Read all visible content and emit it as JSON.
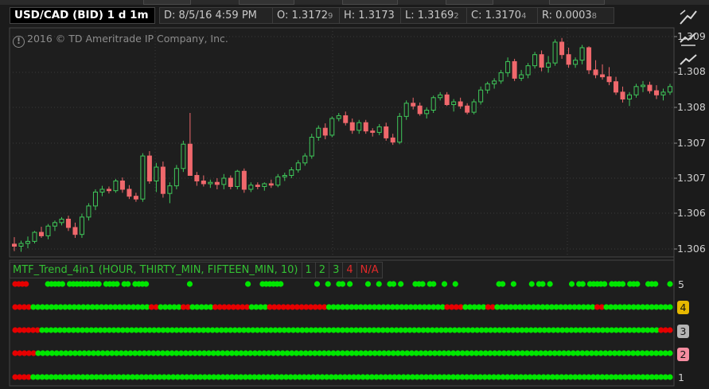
{
  "header": {
    "symbol": "USD/CAD (BID) 1 d 1m",
    "date": "D: 8/5/16 4:59 PM",
    "open": "O: 1.3172",
    "open_sub": "9",
    "high": "H: 1.3173",
    "low": "L: 1.3169",
    "low_sub": "2",
    "close": "C: 1.3170",
    "close_sub": "4",
    "range": "R: 0.0003",
    "range_sub": "8"
  },
  "copyright": "2016 © TD Ameritrade IP Company, Inc.",
  "price_axis": {
    "labels": [
      "1.309",
      "1.308",
      "1.308",
      "1.307",
      "1.307",
      "1.306",
      "1.306"
    ]
  },
  "study": {
    "name": "MTF_Trend_4in1 (HOUR, THIRTY_MIN, FIFTEEN_MIN, 10)",
    "plot1": "1",
    "plot2": "2",
    "plot3": "3",
    "plot4": "4",
    "na": "N/A",
    "row_labels": [
      "5",
      "4",
      "3",
      "2",
      "1"
    ]
  },
  "colors": {
    "up": "#3fc85a",
    "down": "#f0686c",
    "dot_green": "#00e600",
    "dot_red": "#e60000",
    "badge4": "#e6b800",
    "badge3": "#b4b4b4",
    "badge2": "#f58ca0"
  },
  "chart_data": {
    "type": "candlestick",
    "price_range": [
      1.30595,
      1.3091
    ],
    "candles": [
      [
        1.30611,
        1.30621,
        1.30601,
        1.30608
      ],
      [
        1.30608,
        1.30616,
        1.306,
        1.30612
      ],
      [
        1.30612,
        1.30622,
        1.30605,
        1.30615
      ],
      [
        1.30615,
        1.3063,
        1.30612,
        1.30628
      ],
      [
        1.30628,
        1.30636,
        1.3062,
        1.30623
      ],
      [
        1.30623,
        1.3064,
        1.30618,
        1.30637
      ],
      [
        1.30637,
        1.30645,
        1.3063,
        1.30642
      ],
      [
        1.30642,
        1.3065,
        1.30638,
        1.30647
      ],
      [
        1.30647,
        1.30652,
        1.3063,
        1.30635
      ],
      [
        1.30635,
        1.30642,
        1.3062,
        1.30625
      ],
      [
        1.30625,
        1.30655,
        1.3062,
        1.3065
      ],
      [
        1.3065,
        1.3067,
        1.30645,
        1.30666
      ],
      [
        1.30666,
        1.3069,
        1.3066,
        1.30686
      ],
      [
        1.30686,
        1.30695,
        1.3068,
        1.3069
      ],
      [
        1.3069,
        1.30694,
        1.30684,
        1.30688
      ],
      [
        1.30688,
        1.30705,
        1.30685,
        1.30702
      ],
      [
        1.30702,
        1.30707,
        1.30685,
        1.3069
      ],
      [
        1.3069,
        1.30696,
        1.30676,
        1.3068
      ],
      [
        1.3068,
        1.30685,
        1.30672,
        1.30676
      ],
      [
        1.30676,
        1.30742,
        1.30672,
        1.30738
      ],
      [
        1.30738,
        1.30745,
        1.30698,
        1.30702
      ],
      [
        1.30702,
        1.30728,
        1.30686,
        1.30722
      ],
      [
        1.30722,
        1.3073,
        1.30678,
        1.30684
      ],
      [
        1.30684,
        1.307,
        1.3067,
        1.30695
      ],
      [
        1.30695,
        1.30725,
        1.3069,
        1.3072
      ],
      [
        1.3072,
        1.3076,
        1.30715,
        1.30755
      ],
      [
        1.30755,
        1.308,
        1.30735,
        1.3071
      ],
      [
        1.3071,
        1.30715,
        1.30695,
        1.30702
      ],
      [
        1.30702,
        1.3071,
        1.30694,
        1.30698
      ],
      [
        1.30698,
        1.30704,
        1.30692,
        1.307
      ],
      [
        1.307,
        1.30706,
        1.3069,
        1.30697
      ],
      [
        1.30697,
        1.30712,
        1.3069,
        1.30706
      ],
      [
        1.30706,
        1.3071,
        1.3069,
        1.30694
      ],
      [
        1.30694,
        1.30718,
        1.3069,
        1.30716
      ],
      [
        1.30716,
        1.3072,
        1.30685,
        1.3069
      ],
      [
        1.3069,
        1.307,
        1.30686,
        1.30696
      ],
      [
        1.30696,
        1.307,
        1.3069,
        1.30694
      ],
      [
        1.30694,
        1.307,
        1.30688,
        1.30698
      ],
      [
        1.30698,
        1.30704,
        1.30692,
        1.30696
      ],
      [
        1.30696,
        1.30712,
        1.30693,
        1.30708
      ],
      [
        1.30708,
        1.30714,
        1.30702,
        1.3071
      ],
      [
        1.3071,
        1.30722,
        1.30706,
        1.30718
      ],
      [
        1.30718,
        1.30732,
        1.30714,
        1.30728
      ],
      [
        1.30728,
        1.30742,
        1.30724,
        1.30738
      ],
      [
        1.30738,
        1.3077,
        1.30734,
        1.30765
      ],
      [
        1.30765,
        1.30782,
        1.3076,
        1.30778
      ],
      [
        1.30778,
        1.30785,
        1.30762,
        1.30768
      ],
      [
        1.30768,
        1.30795,
        1.30765,
        1.30792
      ],
      [
        1.30792,
        1.308,
        1.30788,
        1.30796
      ],
      [
        1.30796,
        1.30802,
        1.30782,
        1.30786
      ],
      [
        1.30786,
        1.30792,
        1.3077,
        1.30775
      ],
      [
        1.30775,
        1.3079,
        1.3077,
        1.30786
      ],
      [
        1.30786,
        1.3079,
        1.3077,
        1.30774
      ],
      [
        1.30774,
        1.30778,
        1.30766,
        1.30772
      ],
      [
        1.30772,
        1.30784,
        1.30768,
        1.3078
      ],
      [
        1.3078,
        1.30786,
        1.3076,
        1.30764
      ],
      [
        1.30764,
        1.3077,
        1.30754,
        1.30758
      ],
      [
        1.30758,
        1.308,
        1.30755,
        1.30795
      ],
      [
        1.30795,
        1.30818,
        1.3079,
        1.30814
      ],
      [
        1.30814,
        1.30822,
        1.30805,
        1.3081
      ],
      [
        1.3081,
        1.30815,
        1.30796,
        1.30799
      ],
      [
        1.30799,
        1.30808,
        1.30792,
        1.30804
      ],
      [
        1.30804,
        1.30825,
        1.308,
        1.30822
      ],
      [
        1.30822,
        1.3083,
        1.30818,
        1.30826
      ],
      [
        1.30826,
        1.3083,
        1.3081,
        1.30812
      ],
      [
        1.30812,
        1.3082,
        1.30802,
        1.30816
      ],
      [
        1.30816,
        1.30822,
        1.30806,
        1.3081
      ],
      [
        1.3081,
        1.30814,
        1.30798,
        1.30801
      ],
      [
        1.30801,
        1.3082,
        1.30798,
        1.30816
      ],
      [
        1.30816,
        1.30838,
        1.30812,
        1.30833
      ],
      [
        1.30833,
        1.30845,
        1.30828,
        1.30842
      ],
      [
        1.30842,
        1.3085,
        1.30835,
        1.30846
      ],
      [
        1.30846,
        1.30862,
        1.30842,
        1.30858
      ],
      [
        1.30858,
        1.3088,
        1.30852,
        1.30874
      ],
      [
        1.30874,
        1.30878,
        1.30846,
        1.3085
      ],
      [
        1.3085,
        1.30862,
        1.30846,
        1.30855
      ],
      [
        1.30855,
        1.30872,
        1.3085,
        1.30868
      ],
      [
        1.30868,
        1.30888,
        1.30864,
        1.30884
      ],
      [
        1.30884,
        1.3089,
        1.3086,
        1.30866
      ],
      [
        1.30866,
        1.30882,
        1.30858,
        1.30872
      ],
      [
        1.30872,
        1.30906,
        1.30868,
        1.30902
      ],
      [
        1.30902,
        1.30908,
        1.30878,
        1.30884
      ],
      [
        1.30884,
        1.30894,
        1.30865,
        1.3087
      ],
      [
        1.3087,
        1.3088,
        1.30865,
        1.30876
      ],
      [
        1.30876,
        1.30898,
        1.3087,
        1.30894
      ],
      [
        1.30894,
        1.30896,
        1.30856,
        1.30862
      ],
      [
        1.30862,
        1.30876,
        1.3085,
        1.30855
      ],
      [
        1.30855,
        1.3087,
        1.30848,
        1.30852
      ],
      [
        1.30852,
        1.30866,
        1.3084,
        1.30845
      ],
      [
        1.30845,
        1.30852,
        1.30826,
        1.3083
      ],
      [
        1.3083,
        1.30838,
        1.30815,
        1.3082
      ],
      [
        1.3082,
        1.3083,
        1.3081,
        1.30826
      ],
      [
        1.30826,
        1.30842,
        1.30822,
        1.30838
      ],
      [
        1.30838,
        1.30846,
        1.3083,
        1.3084
      ],
      [
        1.3084,
        1.30845,
        1.30828,
        1.30832
      ],
      [
        1.30832,
        1.3084,
        1.3082,
        1.30826
      ],
      [
        1.30826,
        1.30835,
        1.30818,
        1.3083
      ],
      [
        1.3083,
        1.30842,
        1.30826,
        1.30838
      ]
    ],
    "trend_rows": [
      {
        "label": "5",
        "values": "RRRR_____GGGGG_GGGGGGGGG_GGGG_GG_GGGG___________G_______________G___GGGGGG_________G__G__GG_G____G__G__GG_G___GGG_GG__G__G___________GG__G____G_GG_G_____G_GG_GGGGG_GGGG_GGG__GGG___G"
      },
      {
        "label": "4",
        "values": "RRRRGGGGGGGGGGGGGGGGGGGGGGGGGGRRGGGGGRRGGGGGRRRRRRRRGGGGRRRRRRRRRRRRRGGGGGGGGGGGGGGGGGGGGGGGGGGRRRRGGGGGRRGGGGGGGGGGGGGGGGGGGGGGRRGGGGGGGGGGGGGGG"
      },
      {
        "label": "3",
        "values": "RRRRRRGGGGGGGGGGGGGGGGGGGGGGGGGGGGGGGGGGGGGGGGGGGGGGGGGGGGGGGGGGGGGGGGGGGGGGGGGGGGGGGGGGGGGGGGGGGGGGGGGGGGGGGGGGGGGGGGGGGGGGGGGGGGGGGGGGGGGGGGGGRRR"
      },
      {
        "label": "2",
        "values": "RRRRRGGGGGGGGGGGGGGGGGGGGGGGGGGGGGGGGGGGGGGGGGGGGGGGGGGGGGGGGGGGGGGGGGGGGGGGGGGGGGGGGGGGGGGGGGGGGGGGGGGGGGGGGGGGGGGGGGGGGGGGGGGGGGGGGGGGGGGGGGG"
      },
      {
        "label": "1",
        "values": "RRRRGGGGGGGGGGGGGGGGGGGGGGGGGGGGGGGGGGGGGGGGGGGGGGGGGGGGGGGGGGGGGGGGGGGGGGGGGGGGGGGGGGGGGGGGGGGGGGGGGGGGGGGGGGGGGGGGGGGGGGGGGGGGGGGGGGGGGGGGGGGGGG"
      }
    ]
  }
}
